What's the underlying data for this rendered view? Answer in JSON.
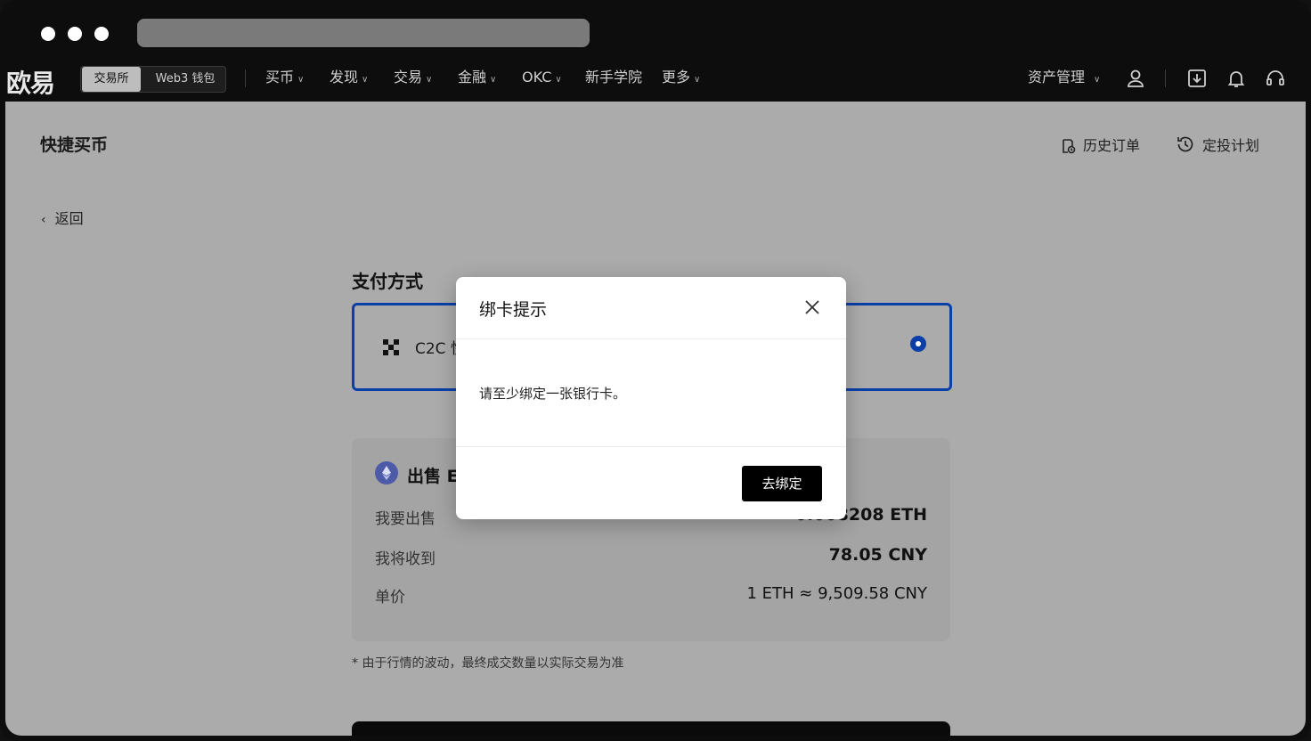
{
  "window": {
    "url_bar": ""
  },
  "nav": {
    "logo": "欧易",
    "mode_tabs": [
      "交易所",
      "Web3 钱包"
    ],
    "items": [
      {
        "label": "买币",
        "has_dropdown": true
      },
      {
        "label": "发现",
        "has_dropdown": true
      },
      {
        "label": "交易",
        "has_dropdown": true
      },
      {
        "label": "金融",
        "has_dropdown": true
      },
      {
        "label": "OKC",
        "has_dropdown": true
      },
      {
        "label": "新手学院",
        "has_dropdown": false
      },
      {
        "label": "更多",
        "has_dropdown": true
      }
    ],
    "asset_management": "资产管理",
    "icons": [
      "user-icon",
      "download-icon",
      "bell-icon",
      "headset-icon"
    ]
  },
  "header": {
    "title": "快捷买币",
    "history_orders": "历史订单",
    "recurring_plan": "定投计划"
  },
  "back_label": "返回",
  "payment": {
    "title": "支付方式",
    "method_label": "C2C 快"
  },
  "sell": {
    "title": "出售 E",
    "rows": [
      {
        "label": "我要出售",
        "value": "0.008208 ETH"
      },
      {
        "label": "我将收到",
        "value": "78.05 CNY"
      },
      {
        "label": "单价",
        "value": "1 ETH ≈ 9,509.58 CNY"
      }
    ],
    "note": "* 由于行情的波动，最终成交数量以实际交易为准"
  },
  "modal": {
    "title": "绑卡提示",
    "message": "请至少绑定一张银行卡。",
    "confirm_label": "去绑定"
  },
  "colors": {
    "accent": "#0b3fa8",
    "overlay": "#ababab",
    "primary_button": "#000000"
  }
}
